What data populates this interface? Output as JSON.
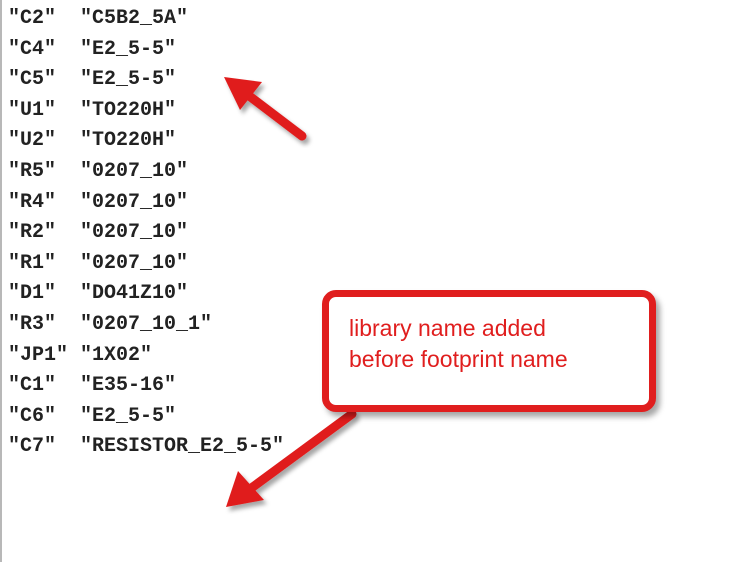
{
  "editor": {
    "lines": [
      "\"C2\"  \"C5B2_5A\"",
      "\"C4\"  \"E2_5-5\"",
      "\"C5\"  \"E2_5-5\"",
      "\"U1\"  \"TO220H\"",
      "\"U2\"  \"TO220H\"",
      "\"R5\"  \"0207_10\"",
      "\"R4\"  \"0207_10\"",
      "\"R2\"  \"0207_10\"",
      "\"R1\"  \"0207_10\"",
      "\"D1\"  \"DO41Z10\"",
      "\"R3\"  \"0207_10_1\"",
      "\"JP1\" \"1X02\"",
      "\"C1\"  \"E35-16\"",
      "\"C6\"  \"E2_5-5\"",
      "\"C7\"  \"RESISTOR_E2_5-5\""
    ]
  },
  "callout": {
    "line1": "library name added",
    "line2": "before footprint name",
    "color": "#e01e1e"
  },
  "arrows": {
    "color": "#e01e1e",
    "icon": "arrow-icon"
  }
}
